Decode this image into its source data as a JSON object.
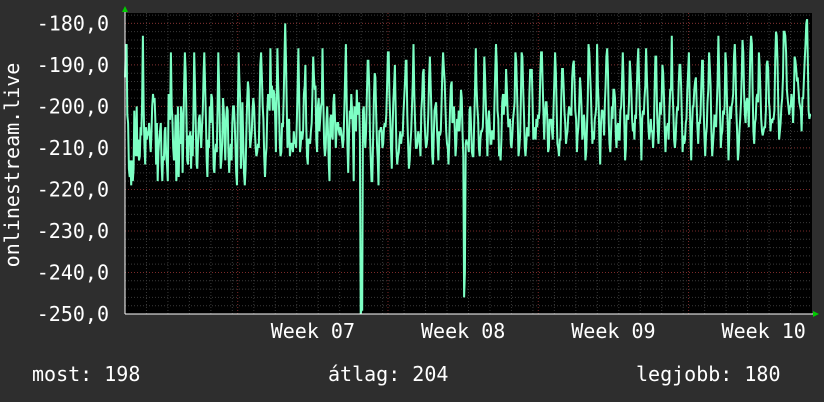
{
  "colors": {
    "background": "#2e2e2e",
    "plot_background": "#000000",
    "grid_major": "#7a2a2a",
    "grid_minor": "#3a3a3a",
    "line": "#7dffc4",
    "axis_arrow": "#00cc00",
    "text": "#ffffff"
  },
  "chart_data": {
    "type": "line",
    "title": "",
    "xlabel": "",
    "ylabel": "onlinestream.live",
    "x_ticks": [
      "Week 07",
      "Week 08",
      "Week 09",
      "Week 10"
    ],
    "y_ticks": [
      "-180,0",
      "-190,0",
      "-200,0",
      "-210,0",
      "-220,0",
      "-230,0",
      "-240,0",
      "-250,0"
    ],
    "y_tick_values": [
      -180,
      -190,
      -200,
      -210,
      -220,
      -230,
      -240,
      -250
    ],
    "xlim": [
      0,
      32
    ],
    "ylim": [
      -250,
      -177.5
    ],
    "grid": true,
    "series": [
      {
        "values": [
          -193,
          -186,
          -185,
          -202,
          -204,
          -215,
          -217,
          -213,
          -219,
          -213,
          -218,
          -215,
          -201,
          -210,
          -212,
          -200,
          -212,
          -208,
          -213,
          -212,
          -205,
          -207,
          -199,
          -183,
          -201,
          -209,
          -214,
          -205,
          -208,
          -206,
          -207,
          -204,
          -208,
          -211,
          -207,
          -200,
          -197,
          -199,
          -198,
          -203,
          -214,
          -204,
          -218,
          -211,
          -208,
          -206,
          -204,
          -214,
          -218,
          -212,
          -213,
          -206,
          -205,
          -212,
          -214,
          -218,
          -197,
          -203,
          -203,
          -187,
          -200,
          -203,
          -210,
          -213,
          -211,
          -202,
          -218,
          -214,
          -200,
          -217,
          -208,
          -209,
          -200,
          -202,
          -216,
          -208,
          -195,
          -187,
          -192,
          -202,
          -213,
          -214,
          -207,
          -208,
          -206,
          -215,
          -207,
          -212,
          -202,
          -187,
          -195,
          -205,
          -214,
          -215,
          -208,
          -203,
          -202,
          -206,
          -210,
          -205,
          -201,
          -192,
          -187,
          -195,
          -203,
          -213,
          -217,
          -208,
          -210,
          -200,
          -204,
          -197,
          -198,
          -205,
          -215,
          -216,
          -211,
          -209,
          -211,
          -200,
          -187,
          -195,
          -206,
          -215,
          -213,
          -209,
          -198,
          -201,
          -208,
          -213,
          -203,
          -200,
          -201,
          -211,
          -216,
          -211,
          -209,
          -213,
          -204,
          -200,
          -200,
          -204,
          -209,
          -216,
          -219,
          -202,
          -187,
          -193,
          -198,
          -215,
          -210,
          -199,
          -208,
          -216,
          -219,
          -215,
          -207,
          -199,
          -194,
          -196,
          -204,
          -210,
          -208,
          -206,
          -201,
          -198,
          -200,
          -206,
          -210,
          -212,
          -211,
          -209,
          -210,
          -201,
          -190,
          -187,
          -193,
          -200,
          -203,
          -212,
          -217,
          -212,
          -210,
          -201,
          -197,
          -199,
          -201,
          -186,
          -198,
          -195,
          -201,
          -196,
          -197,
          -202,
          -211,
          -198,
          -186,
          -195,
          -200,
          -209,
          -212,
          -211,
          -204,
          -205,
          -198,
          -189,
          -180,
          -189,
          -201,
          -210,
          -204,
          -203,
          -212,
          -210,
          -209,
          -209,
          -211,
          -206,
          -209,
          -208,
          -210,
          -203,
          -194,
          -186,
          -198,
          -211,
          -209,
          -206,
          -208,
          -206,
          -197,
          -195,
          -190,
          -204,
          -212,
          -214,
          -208,
          -208,
          -209,
          -206,
          -204,
          -197,
          -188,
          -193,
          -196,
          -195,
          -208,
          -211,
          -200,
          -198,
          -206,
          -203,
          -200,
          -199,
          -186,
          -198,
          -209,
          -212,
          -210,
          -204,
          -200,
          -206,
          -214,
          -218,
          -203,
          -202,
          -207,
          -208,
          -199,
          -197,
          -203,
          -210,
          -206,
          -204,
          -204,
          -206,
          -207,
          -205,
          -206,
          -208,
          -210,
          -208,
          -201,
          -193,
          -185,
          -199,
          -209,
          -216,
          -207,
          -201,
          -203,
          -197,
          -201,
          -206,
          -218,
          -200,
          -202,
          -206,
          -196,
          -202,
          -201,
          -199,
          -208,
          -250,
          -249,
          -249,
          -201,
          -200,
          -207,
          -210,
          -206,
          -197,
          -189,
          -189,
          -195,
          -207,
          -213,
          -218,
          -218,
          -208,
          -198,
          -192,
          -193,
          -202,
          -209,
          -213,
          -219,
          -206,
          -206,
          -205,
          -206,
          -210,
          -209,
          -205,
          -204,
          -205,
          -202,
          -195,
          -187,
          -187,
          -197,
          -203,
          -210,
          -215,
          -206,
          -199,
          -195,
          -190,
          -201,
          -210,
          -214,
          -212,
          -211,
          -208,
          -206,
          -209,
          -207,
          -207,
          -202,
          -198,
          -194,
          -189,
          -189,
          -202,
          -209,
          -215,
          -213,
          -209,
          -206,
          -200,
          -194,
          -185,
          -197,
          -204,
          -210,
          -210,
          -209,
          -206,
          -207,
          -209,
          -212,
          -201,
          -198,
          -192,
          -191,
          -202,
          -207,
          -210,
          -209,
          -207,
          -202,
          -193,
          -188,
          -195,
          -201,
          -212,
          -214,
          -207,
          -201,
          -200,
          -199,
          -205,
          -209,
          -213,
          -206,
          -207,
          -206,
          -200,
          -192,
          -187,
          -191,
          -194,
          -200,
          -206,
          -209,
          -210,
          -214,
          -208,
          -200,
          -195,
          -194,
          -204,
          -202,
          -200,
          -206,
          -212,
          -209,
          -203,
          -206,
          -201,
          -206,
          -202,
          -196,
          -198,
          -206,
          -212,
          -246,
          -240,
          -209,
          -208,
          -209,
          -209,
          -211,
          -201,
          -200,
          -205,
          -211,
          -212,
          -212,
          -204,
          -196,
          -186,
          -195,
          -200,
          -203,
          -210,
          -212,
          -208,
          -206,
          -206,
          -205,
          -200,
          -188,
          -193,
          -200,
          -206,
          -212,
          -204,
          -201,
          -205,
          -209,
          -209,
          -206,
          -206,
          -208,
          -200,
          -192,
          -185,
          -190,
          -201,
          -203,
          -212,
          -211,
          -213,
          -208,
          -199,
          -197,
          -202,
          -197,
          -200,
          -191,
          -196,
          -201,
          -205,
          -204,
          -203,
          -209,
          -210,
          -207,
          -203,
          -201,
          -199,
          -187,
          -189,
          -196,
          -204,
          -212,
          -210,
          -207,
          -198,
          -187,
          -188,
          -196,
          -202,
          -210,
          -212,
          -209,
          -205,
          -207,
          -207,
          -197,
          -191,
          -193,
          -191,
          -198,
          -208,
          -206,
          -205,
          -208,
          -203,
          -205,
          -202,
          -203,
          -201,
          -192,
          -187,
          -187,
          -194,
          -201,
          -208,
          -202,
          -199,
          -199,
          -203,
          -211,
          -210,
          -203,
          -204,
          -203,
          -206,
          -208,
          -201,
          -194,
          -187,
          -192,
          -200,
          -209,
          -210,
          -212,
          -208,
          -208,
          -198,
          -191,
          -191,
          -195,
          -201,
          -204,
          -209,
          -207,
          -206,
          -202,
          -200,
          -201,
          -202,
          -202,
          -193,
          -190,
          -189,
          -194,
          -201,
          -203,
          -211,
          -207,
          -205,
          -200,
          -193,
          -196,
          -200,
          -208,
          -206,
          -202,
          -204,
          -213,
          -211,
          -205,
          -198,
          -185,
          -187,
          -192,
          -197,
          -203,
          -209,
          -206,
          -208,
          -203,
          -202,
          -200,
          -185,
          -195,
          -199,
          -208,
          -214,
          -204,
          -201,
          -201,
          -202,
          -207,
          -199,
          -195,
          -188,
          -186,
          -192,
          -204,
          -209,
          -211,
          -206,
          -200,
          -203,
          -196,
          -196,
          -198,
          -207,
          -210,
          -205,
          -204,
          -208,
          -208,
          -201,
          -200,
          -194,
          -187,
          -193,
          -204,
          -213,
          -210,
          -202,
          -203,
          -203,
          -199,
          -189,
          -192,
          -196,
          -203,
          -206,
          -204,
          -208,
          -202,
          -203,
          -196,
          -190,
          -186,
          -194,
          -201,
          -205,
          -213,
          -203,
          -201,
          -202,
          -198,
          -195,
          -186,
          -193,
          -198,
          -205,
          -208,
          -206,
          -203,
          -206,
          -206,
          -210,
          -206,
          -196,
          -188,
          -188,
          -201,
          -206,
          -209,
          -204,
          -199,
          -202,
          -199,
          -190,
          -192,
          -198,
          -206,
          -211,
          -205,
          -205,
          -204,
          -208,
          -201,
          -196,
          -196,
          -183,
          -196,
          -201,
          -208,
          -210,
          -208,
          -203,
          -200,
          -201,
          -194,
          -190,
          -190,
          -195,
          -203,
          -211,
          -207,
          -209,
          -208,
          -204,
          -203,
          -196,
          -192,
          -187,
          -197,
          -206,
          -213,
          -205,
          -200,
          -200,
          -196,
          -194,
          -193,
          -199,
          -205,
          -209,
          -204,
          -204,
          -202,
          -195,
          -189,
          -189,
          -200,
          -207,
          -212,
          -207,
          -205,
          -199,
          -196,
          -187,
          -191,
          -195,
          -206,
          -212,
          -209,
          -206,
          -202,
          -203,
          -205,
          -199,
          -194,
          -183,
          -192,
          -201,
          -210,
          -207,
          -206,
          -201,
          -202,
          -200,
          -187,
          -190,
          -199,
          -205,
          -213,
          -207,
          -200,
          -203,
          -200,
          -199,
          -197,
          -188,
          -185,
          -190,
          -201,
          -206,
          -213,
          -211,
          -206,
          -203,
          -199,
          -192,
          -184,
          -187,
          -197,
          -202,
          -204,
          -199,
          -198,
          -200,
          -205,
          -197,
          -187,
          -183,
          -185,
          -196,
          -206,
          -209,
          -204,
          -203,
          -198,
          -197,
          -199,
          -187,
          -190,
          -196,
          -203,
          -206,
          -207,
          -206,
          -205,
          -205,
          -201,
          -190,
          -189,
          -191,
          -199,
          -201,
          -206,
          -203,
          -204,
          -203,
          -203,
          -201,
          -189,
          -182,
          -183,
          -189,
          -200,
          -208,
          -206,
          -204,
          -200,
          -198,
          -193,
          -182,
          -182,
          -183,
          -187,
          -196,
          -198,
          -200,
          -202,
          -200,
          -200,
          -197,
          -199,
          -204,
          -198,
          -188,
          -189,
          -191,
          -194,
          -193,
          -196,
          -199,
          -200,
          -201,
          -206,
          -198,
          -198,
          -193,
          -189,
          -185,
          -180,
          -179,
          -190,
          -201,
          -203,
          -202,
          -202
        ]
      }
    ]
  },
  "footer": {
    "current": "most: 198",
    "average": "átlag: 204",
    "best": "legjobb: 180"
  }
}
